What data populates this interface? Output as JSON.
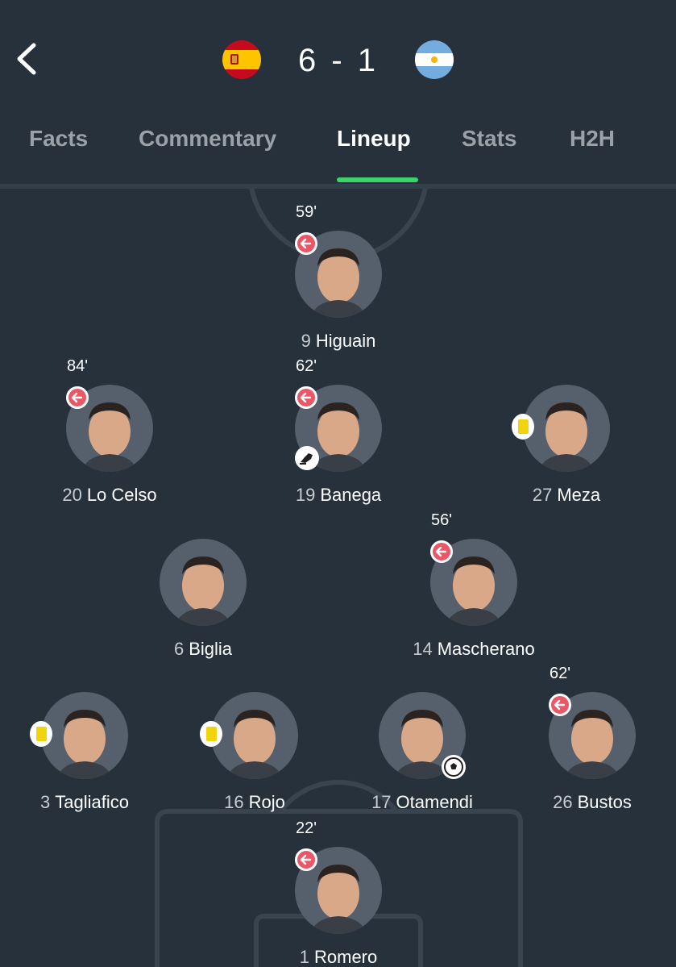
{
  "header": {
    "home_team_flag": "spain-flag-icon",
    "away_team_flag": "argentina-flag-icon",
    "score": "6 - 1",
    "back_icon": "chevron-left-icon"
  },
  "tabs": [
    {
      "label": "Facts",
      "active": false
    },
    {
      "label": "Commentary",
      "active": false
    },
    {
      "label": "Lineup",
      "active": true
    },
    {
      "label": "Stats",
      "active": false
    },
    {
      "label": "H2H",
      "active": false
    }
  ],
  "colors": {
    "background": "#26313c",
    "tab_indicator": "#3bd46c",
    "sub_badge": "#ea5766",
    "yellow_card": "#f2d40c",
    "avatar_bg": "#56606c"
  },
  "players": [
    {
      "number": "9",
      "name": "Higuain",
      "sub_time": "59'",
      "subbed_off": true,
      "yellow_card": false,
      "event": ""
    },
    {
      "number": "20",
      "name": "Lo Celso",
      "sub_time": "84'",
      "subbed_off": true,
      "yellow_card": false,
      "event": ""
    },
    {
      "number": "19",
      "name": "Banega",
      "sub_time": "62'",
      "subbed_off": true,
      "yellow_card": false,
      "event": "assist-boot-icon"
    },
    {
      "number": "27",
      "name": "Meza",
      "sub_time": "",
      "subbed_off": false,
      "yellow_card": true,
      "event": ""
    },
    {
      "number": "6",
      "name": "Biglia",
      "sub_time": "",
      "subbed_off": false,
      "yellow_card": false,
      "event": ""
    },
    {
      "number": "14",
      "name": "Mascherano",
      "sub_time": "56'",
      "subbed_off": true,
      "yellow_card": false,
      "event": ""
    },
    {
      "number": "3",
      "name": "Tagliafico",
      "sub_time": "",
      "subbed_off": false,
      "yellow_card": true,
      "event": ""
    },
    {
      "number": "16",
      "name": "Rojo",
      "sub_time": "",
      "subbed_off": false,
      "yellow_card": true,
      "event": ""
    },
    {
      "number": "17",
      "name": "Otamendi",
      "sub_time": "",
      "subbed_off": false,
      "yellow_card": false,
      "event": "goal-ball-icon"
    },
    {
      "number": "26",
      "name": "Bustos",
      "sub_time": "62'",
      "subbed_off": true,
      "yellow_card": false,
      "event": ""
    },
    {
      "number": "1",
      "name": "Romero",
      "sub_time": "22'",
      "subbed_off": true,
      "yellow_card": false,
      "event": ""
    }
  ]
}
